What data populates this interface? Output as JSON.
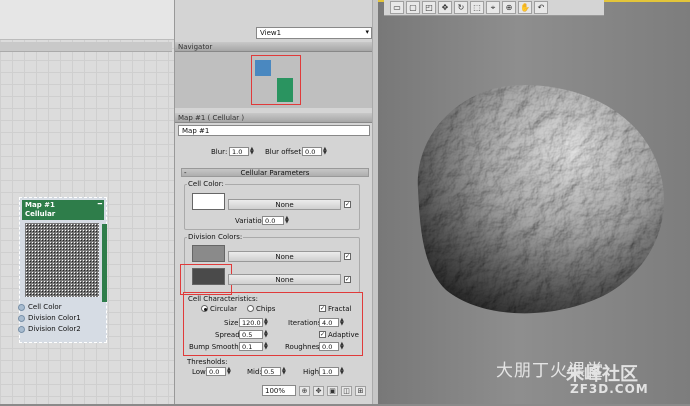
{
  "editor": {
    "view_selector": "View1",
    "node": {
      "title_line1": "Map #1",
      "title_line2": "Cellular",
      "slots": [
        "Cell Color",
        "Division Color1",
        "Division Color2"
      ]
    }
  },
  "navigator": {
    "title": "Navigator"
  },
  "params": {
    "panel_title": "Map #1  ( Cellular )",
    "map_name": "Map #1",
    "blur_label": "Blur:",
    "blur_value": "1.0",
    "blur_offset_label": "Blur offset:",
    "blur_offset_value": "0.0",
    "rollout_title": "Cellular Parameters",
    "cell_color_group": "Cell Color:",
    "cell_color_map": "None",
    "variation_label": "Variation:",
    "variation_value": "0.0",
    "division_colors_group": "Division Colors:",
    "division1_map": "None",
    "division2_map": "None",
    "characteristics_group": "Cell Characteristics:",
    "circular_label": "Circular",
    "chips_label": "Chips",
    "fractal_label": "Fractal",
    "size_label": "Size:",
    "size_value": "120.0",
    "iterations_label": "Iterations:",
    "iterations_value": "4.0",
    "spread_label": "Spread:",
    "spread_value": "0.5",
    "adaptive_label": "Adaptive",
    "bump_label": "Bump Smoothing:",
    "bump_value": "0.1",
    "roughness_label": "Roughness:",
    "roughness_value": "0.0",
    "thresholds_label": "Thresholds:",
    "low_label": "Low:",
    "low_value": "0.0",
    "mid_label": "Mid:",
    "mid_value": "0.5",
    "high_label": "High:",
    "high_value": "1.0"
  },
  "status": {
    "zoom": "100%"
  },
  "watermark": {
    "text1": "大朋丁火课堂",
    "text2": "朱峰社区",
    "text3": "ZF3D.COM"
  },
  "colors": {
    "node_header": "#2e7d4a",
    "highlight": "#e03a3a",
    "cell_color": "#ffffff",
    "division_color1": "#8a8a8a",
    "division_color2": "#4a4a4a"
  }
}
